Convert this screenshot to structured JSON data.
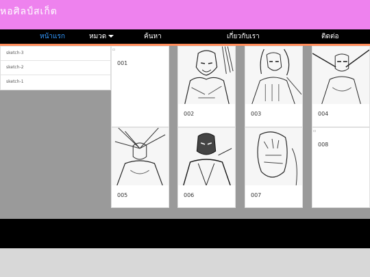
{
  "header": {
    "title": "หอศิลป์สเก็ต"
  },
  "nav": {
    "items": [
      {
        "label": "หน้าแรก",
        "active": true
      },
      {
        "label": "หมวด",
        "dropdown": true
      },
      {
        "label": "ค้นหา"
      },
      {
        "label": "เกี่ยวกับเรา"
      },
      {
        "label": "ติดต่อ"
      }
    ]
  },
  "sidebar": {
    "items": [
      "sketch-3",
      "sketch-2",
      "sketch-1"
    ]
  },
  "gallery": {
    "cards": [
      {
        "caption": "001",
        "image": "broken-image"
      },
      {
        "caption": "002",
        "image": "sketch-warrior"
      },
      {
        "caption": "003",
        "image": "sketch-heroine"
      },
      {
        "caption": "004",
        "image": "sketch-flyer"
      },
      {
        "caption": "005",
        "image": "sketch-winged"
      },
      {
        "caption": "006",
        "image": "sketch-masked"
      },
      {
        "caption": "007",
        "image": "sketch-beast"
      },
      {
        "caption": "008",
        "image": "broken-image"
      }
    ]
  },
  "colors": {
    "header": "#ee82ee",
    "nav": "#000000",
    "accent": "#ff8c5a",
    "active_link": "#3399ff"
  }
}
